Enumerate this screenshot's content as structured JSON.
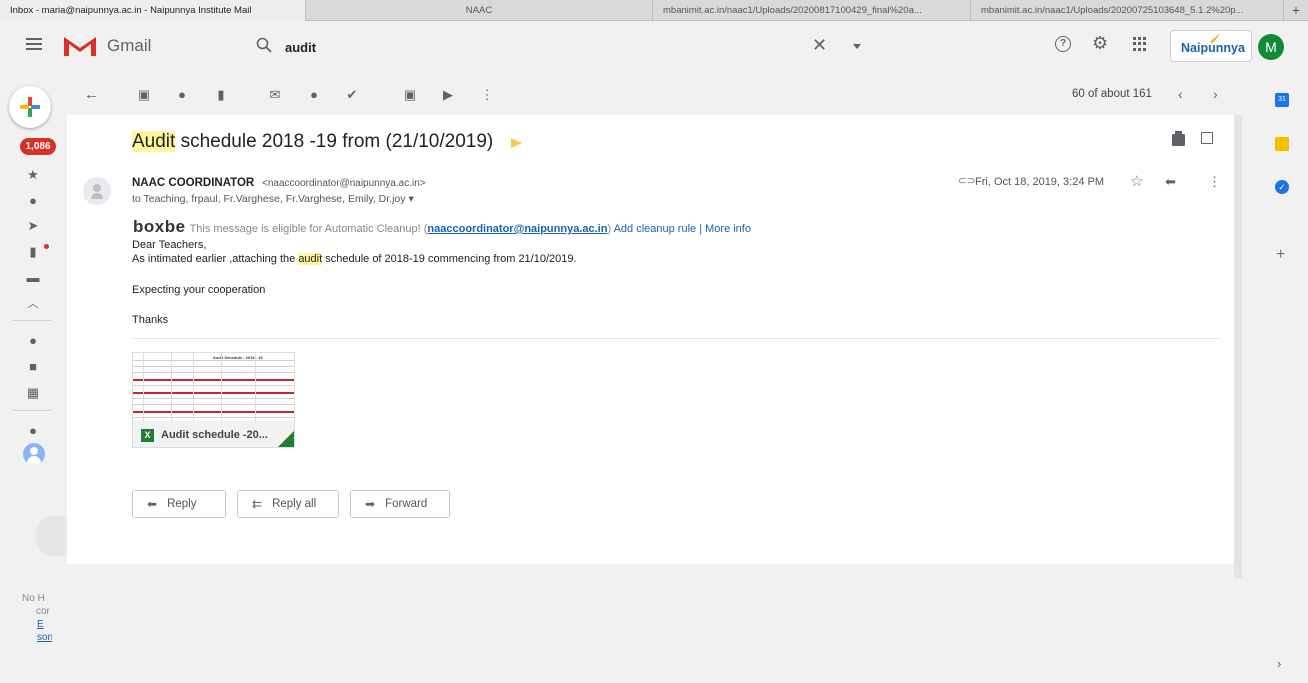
{
  "browser": {
    "tabs": [
      "Inbox - maria@naipunnya.ac.in - Naipunnya Institute Mail",
      "NAAC",
      "mbanimit.ac.in/naac1/Uploads/20200817100429_final%20a...",
      "mbanimit.ac.in/naac1/Uploads/20200725103648_5.1.2%20p..."
    ],
    "new_tab": "+"
  },
  "header": {
    "product": "Gmail",
    "search_value": "audit",
    "org_logo_text": "Naipunnya",
    "avatar_letter": "M",
    "colors": {
      "gmail_red": "#d93025",
      "avatar_green": "#138a36",
      "org_blue": "#1a62b0"
    }
  },
  "left_rail": {
    "unread_badge": "1,086",
    "icons": [
      "star-icon",
      "clock-icon",
      "send-icon",
      "draft-icon",
      "label-icon",
      "chevron-up-icon",
      "chat-icon",
      "video-icon",
      "keyboard-icon",
      "hangouts-icon"
    ],
    "hangouts_text": [
      "No H",
      "cor",
      "E",
      "son"
    ]
  },
  "toolbar": {
    "pager": "60 of about 161"
  },
  "message": {
    "subject_highlight": "Audit",
    "subject_rest": " schedule 2018 -19 from (21/10/2019)",
    "sender_name": "NAAC COORDINATOR",
    "sender_email": "<naaccoordinator@naipunnya.ac.in>",
    "recipients": "to Teaching, frpaul, Fr.Varghese, Fr.Varghese, Emily, Dr.joy",
    "date": "Fri, Oct 18, 2019, 3:24 PM",
    "boxbe": {
      "logo": "boxbe",
      "notice": "This message is eligible for Automatic Cleanup! (",
      "email_link": "naaccoordinator@naipunnya.ac.in",
      "close_paren": ")",
      "add_rule": "Add cleanup rule",
      "separator": " | ",
      "more_info": "More info"
    },
    "body": {
      "greeting": "Dear Teachers,",
      "line1_a": "As intimated earlier ,attaching the ",
      "line1_hl": "audit",
      "line1_b": " schedule of 2018-19 commencing from 21/10/2019.",
      "line2": "Expecting your cooperation",
      "line3": "Thanks"
    },
    "attachment": {
      "name": "Audit schedule -20...",
      "preview_title": "Audit Schedule - 2018 - 19",
      "type_letter": "X"
    }
  },
  "actions": {
    "reply": "Reply",
    "reply_all": "Reply all",
    "forward": "Forward"
  },
  "side_panel": {
    "calendar_label": "31",
    "colors": {
      "calendar": "#1a73e8",
      "keep": "#fbbc04",
      "tasks": "#1a73e8"
    }
  }
}
